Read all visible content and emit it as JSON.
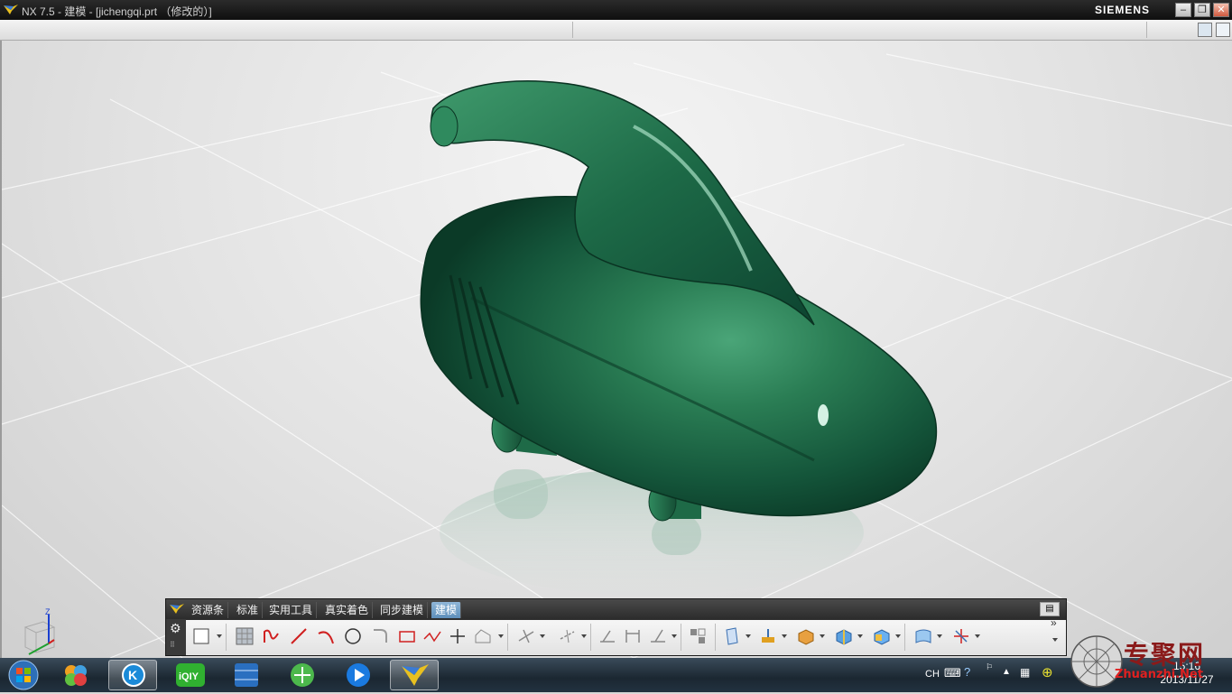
{
  "window": {
    "title": "NX 7.5 - 建模 - [jichengqi.prt （修改的）]",
    "brand": "SIEMENS"
  },
  "ribbon": {
    "tabs": [
      "资源条",
      "标准",
      "实用工具",
      "真实着色",
      "同步建模",
      "建模"
    ],
    "active_tab": "建模",
    "more_label": "»"
  },
  "triad": {
    "z_label": "Z"
  },
  "tray": {
    "language": "CH"
  },
  "clock": {
    "time": "15:16",
    "date": "2013/11/27"
  },
  "watermark": {
    "text": "专聚网",
    "url": "Zhuanzhi.Net"
  },
  "colors": {
    "model_green": "#1f6a45",
    "active_tab": "#6f9cc4",
    "title_bar": "#1a1a1a"
  }
}
